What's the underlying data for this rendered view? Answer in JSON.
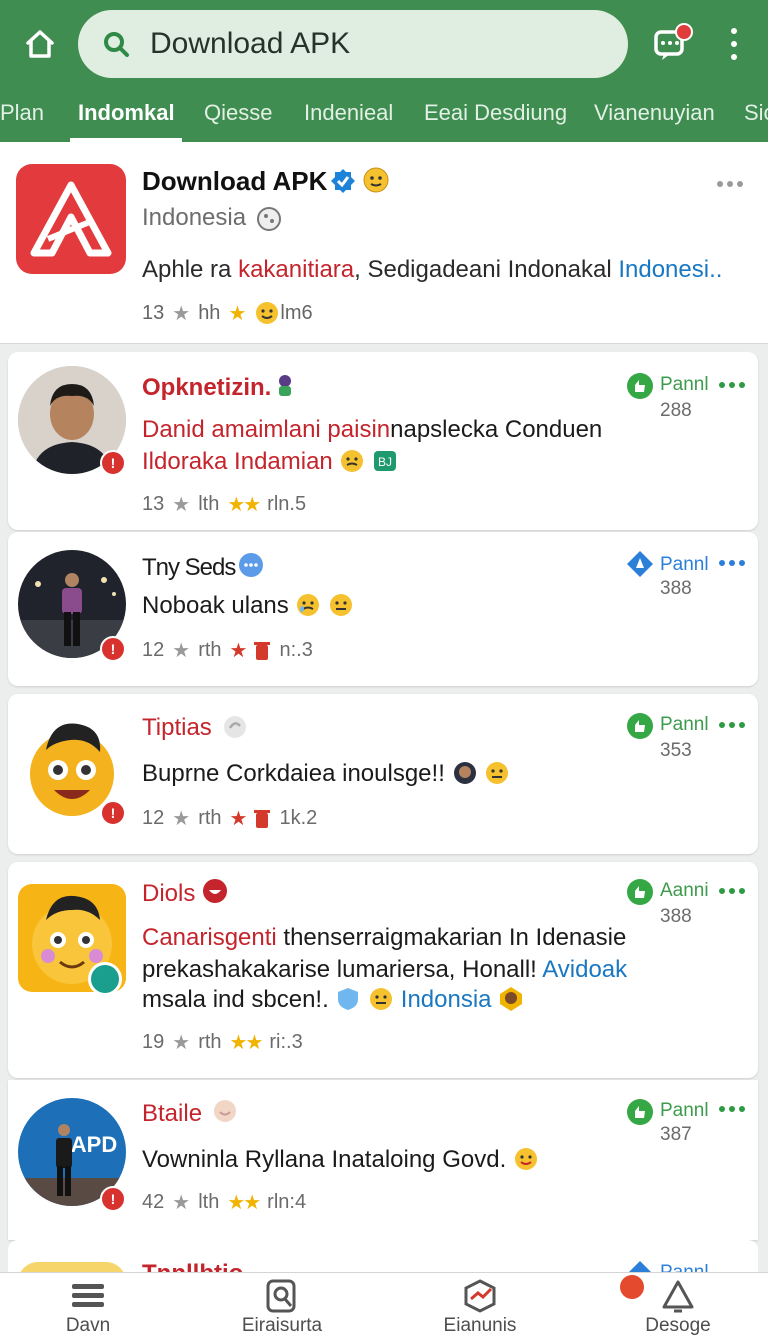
{
  "header": {
    "search_text": "Download APK",
    "icons": {
      "home": "home-icon",
      "search": "search-icon",
      "messages": "chat-notification-icon",
      "more": "more-vertical-icon"
    },
    "accent_color": "#3f8d51"
  },
  "tabs": [
    "Plan",
    "Indomkal",
    "Qiesse",
    "Indenieal",
    "Eeai Desdiung",
    "Vianenuyian",
    "Sic"
  ],
  "app": {
    "title": "Download APK",
    "subtitle": "Indonesia",
    "desc_a": "Aphle ra ",
    "desc_b": "kakanitiara",
    "desc_c": ", Sedigadeani Indonakal ",
    "desc_d": "Indonesi..",
    "meta_num": "13",
    "meta_unit": "hh",
    "meta_tail": "lm6"
  },
  "posts": [
    {
      "name": "Opknetizin.",
      "line1": "Danid amaimlani paisin",
      "line1b": "napslecka Conduen",
      "line2": "Ildoraka Indamian",
      "meta_num": "13",
      "meta_unit": "lth",
      "meta_tail": "rln.5",
      "label": "Pannl",
      "count": "288"
    },
    {
      "name": "Tny Seds",
      "line1": "Noboak ulans",
      "meta_num": "12",
      "meta_unit": "rth",
      "meta_tail": "n:.3",
      "label": "Pannl",
      "count": "388"
    },
    {
      "name": "Tiptias",
      "line1": "Buprne Corkdaiea inoulsge!!",
      "meta_num": "12",
      "meta_unit": "rth",
      "meta_tail": "1k.2",
      "label": "Pannl",
      "count": "353"
    },
    {
      "name": "Diols",
      "line1a": "Canarisgenti",
      "line1b": " thenserraigmakarian In Idenasie",
      "line2a": "prekashakakarise lumariersa, Honall! ",
      "line2b": "Avidoak",
      "line3a": "msala ind sbcen!.",
      "line3b": "Indonsia",
      "meta_num": "19",
      "meta_unit": "rth",
      "meta_tail": "ri:.3",
      "label": "Aanni",
      "count": "388"
    },
    {
      "name": "Btaile",
      "line1": "Vowninla Ryllana Inataloing Govd.",
      "meta_num": "42",
      "meta_unit": "lth",
      "meta_tail": "rln:4",
      "label": "Pannl",
      "count": "387",
      "avatar_text": "APD"
    }
  ],
  "partial": {
    "name": "Tnnllbtio",
    "label": "Pannl"
  },
  "bottom_nav": [
    "Davn",
    "Eiraisurta",
    "Eianunis",
    "Desoge"
  ]
}
